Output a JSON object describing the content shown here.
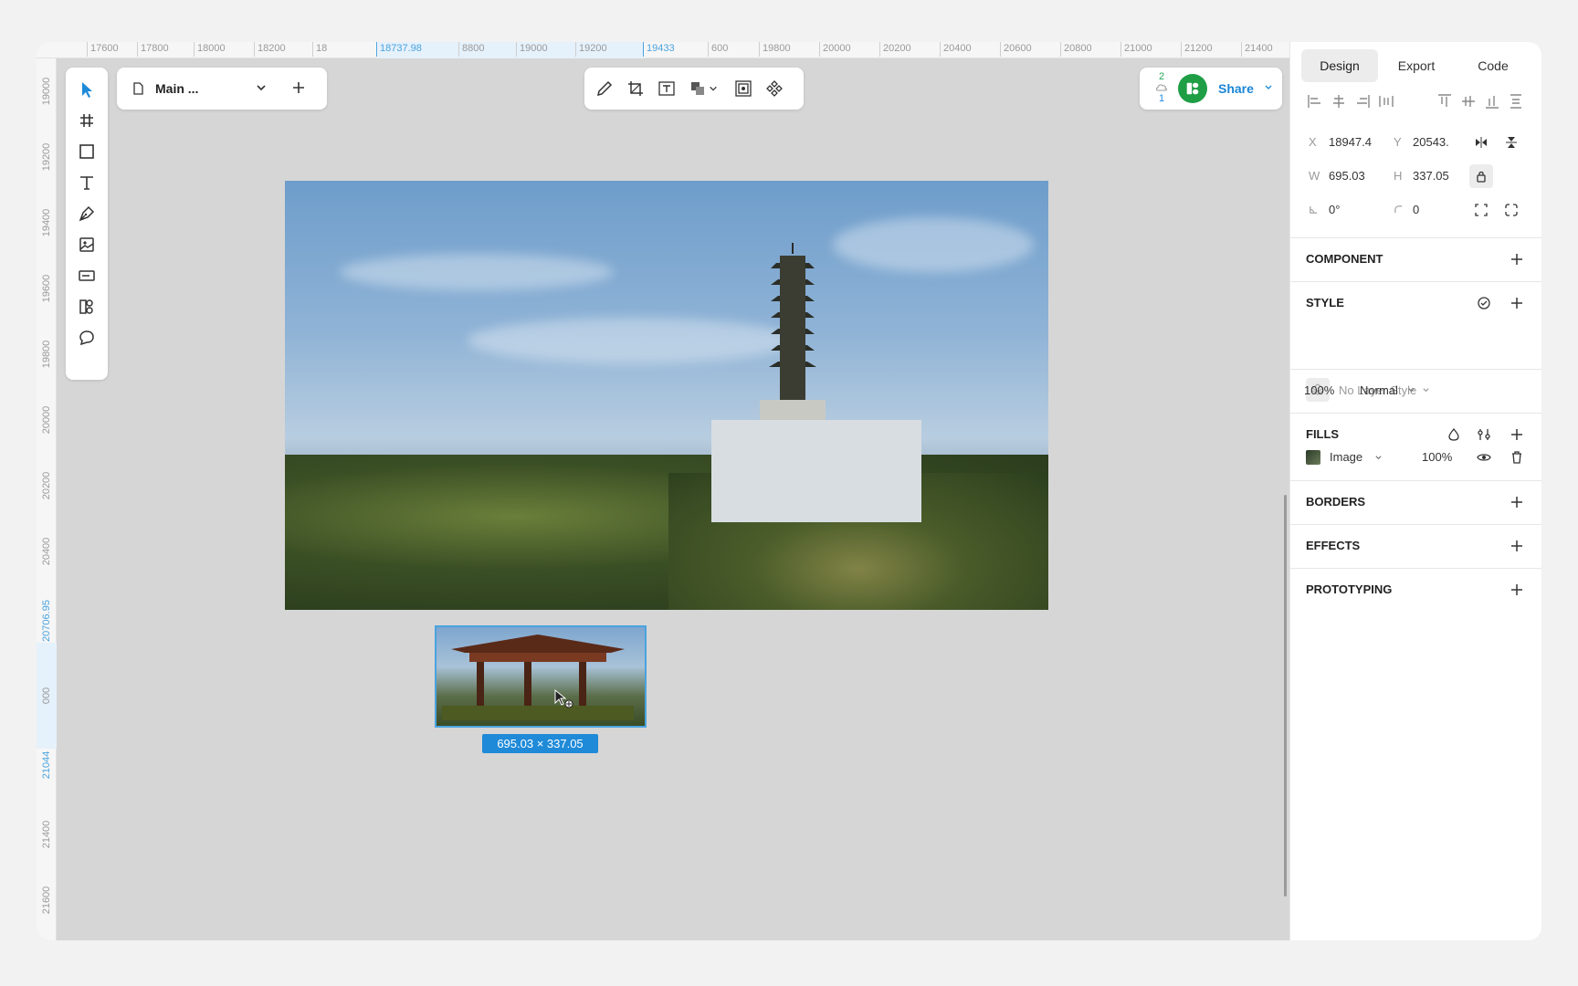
{
  "ruler_top": {
    "ticks": [
      "17600",
      "17800",
      "18000",
      "18200",
      "18",
      "18737.98",
      "8800",
      "19000",
      "19200",
      "19433",
      "600",
      "19800",
      "20000",
      "20200",
      "20400",
      "20600",
      "20800",
      "21000",
      "21200",
      "21400"
    ]
  },
  "ruler_left": {
    "ticks": [
      "19000",
      "19200",
      "19400",
      "19600",
      "19800",
      "20000",
      "20200",
      "20400",
      "20706.95",
      "000",
      "21044",
      "21400",
      "21600"
    ]
  },
  "page_selector": {
    "label": "Main ..."
  },
  "share": {
    "sync_up": "2",
    "sync_down": "1",
    "label": "Share"
  },
  "canvas": {
    "size_badge": "695.03 × 337.05"
  },
  "panel": {
    "tabs": [
      "Design",
      "Export",
      "Code"
    ],
    "x_label": "X",
    "x_value": "18947.4",
    "y_label": "Y",
    "y_value": "20543.",
    "w_label": "W",
    "w_value": "695.03",
    "h_label": "H",
    "h_value": "337.05",
    "rotation": "0°",
    "radius": "0",
    "component_title": "COMPONENT",
    "style_title": "STYLE",
    "layer_style": "No Layer Style",
    "opacity": "100%",
    "blend_mode": "Normal",
    "fills_title": "FILLS",
    "fill_type": "Image",
    "fill_opacity": "100%",
    "borders_title": "BORDERS",
    "effects_title": "EFFECTS",
    "prototyping_title": "PROTOTYPING"
  },
  "colors": {
    "accent": "#1f8ad8",
    "selection": "#4aa3df",
    "canvas": "#d6d6d6",
    "avatar": "#1f9e46"
  }
}
